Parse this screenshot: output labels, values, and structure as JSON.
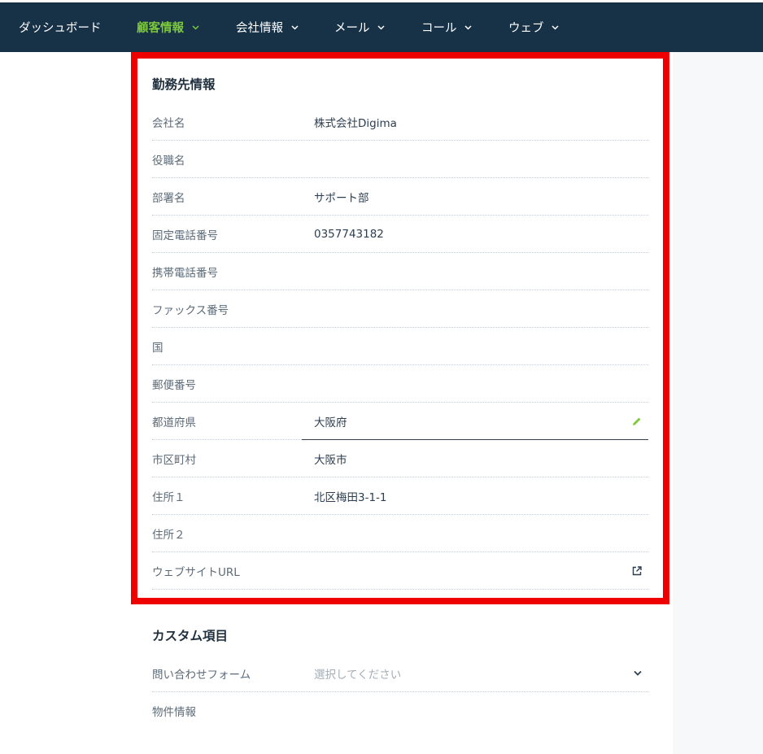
{
  "nav": {
    "items": [
      {
        "label": "ダッシュボード",
        "active": false,
        "dropdown": false
      },
      {
        "label": "顧客情報",
        "active": true,
        "dropdown": true
      },
      {
        "label": "会社情報",
        "active": false,
        "dropdown": true
      },
      {
        "label": "メール",
        "active": false,
        "dropdown": true
      },
      {
        "label": "コール",
        "active": false,
        "dropdown": true
      },
      {
        "label": "ウェブ",
        "active": false,
        "dropdown": true
      }
    ]
  },
  "work_info": {
    "title": "勤務先情報",
    "rows": [
      {
        "label": "会社名",
        "value": "株式会社Digima"
      },
      {
        "label": "役職名",
        "value": ""
      },
      {
        "label": "部署名",
        "value": "サポート部"
      },
      {
        "label": "固定電話番号",
        "value": "0357743182"
      },
      {
        "label": "携帯電話番号",
        "value": ""
      },
      {
        "label": "ファックス番号",
        "value": ""
      },
      {
        "label": "国",
        "value": ""
      },
      {
        "label": "郵便番号",
        "value": ""
      },
      {
        "label": "都道府県",
        "value": "大阪府",
        "icon": "pencil-icon"
      },
      {
        "label": "市区町村",
        "value": "大阪市"
      },
      {
        "label": "住所１",
        "value": "北区梅田3-1-1"
      },
      {
        "label": "住所２",
        "value": ""
      },
      {
        "label": "ウェブサイトURL",
        "value": "",
        "icon": "external-link-icon"
      }
    ]
  },
  "custom_fields": {
    "title": "カスタム項目",
    "rows": [
      {
        "label": "問い合わせフォーム",
        "placeholder": "選択してください",
        "icon": "chevron-down-icon"
      },
      {
        "label": "物件情報",
        "value": ""
      }
    ]
  },
  "colors": {
    "nav_bg": "#173147",
    "nav_active": "#7cc93a",
    "highlight_border": "#ee0000",
    "edit_icon": "#7cc93a"
  }
}
